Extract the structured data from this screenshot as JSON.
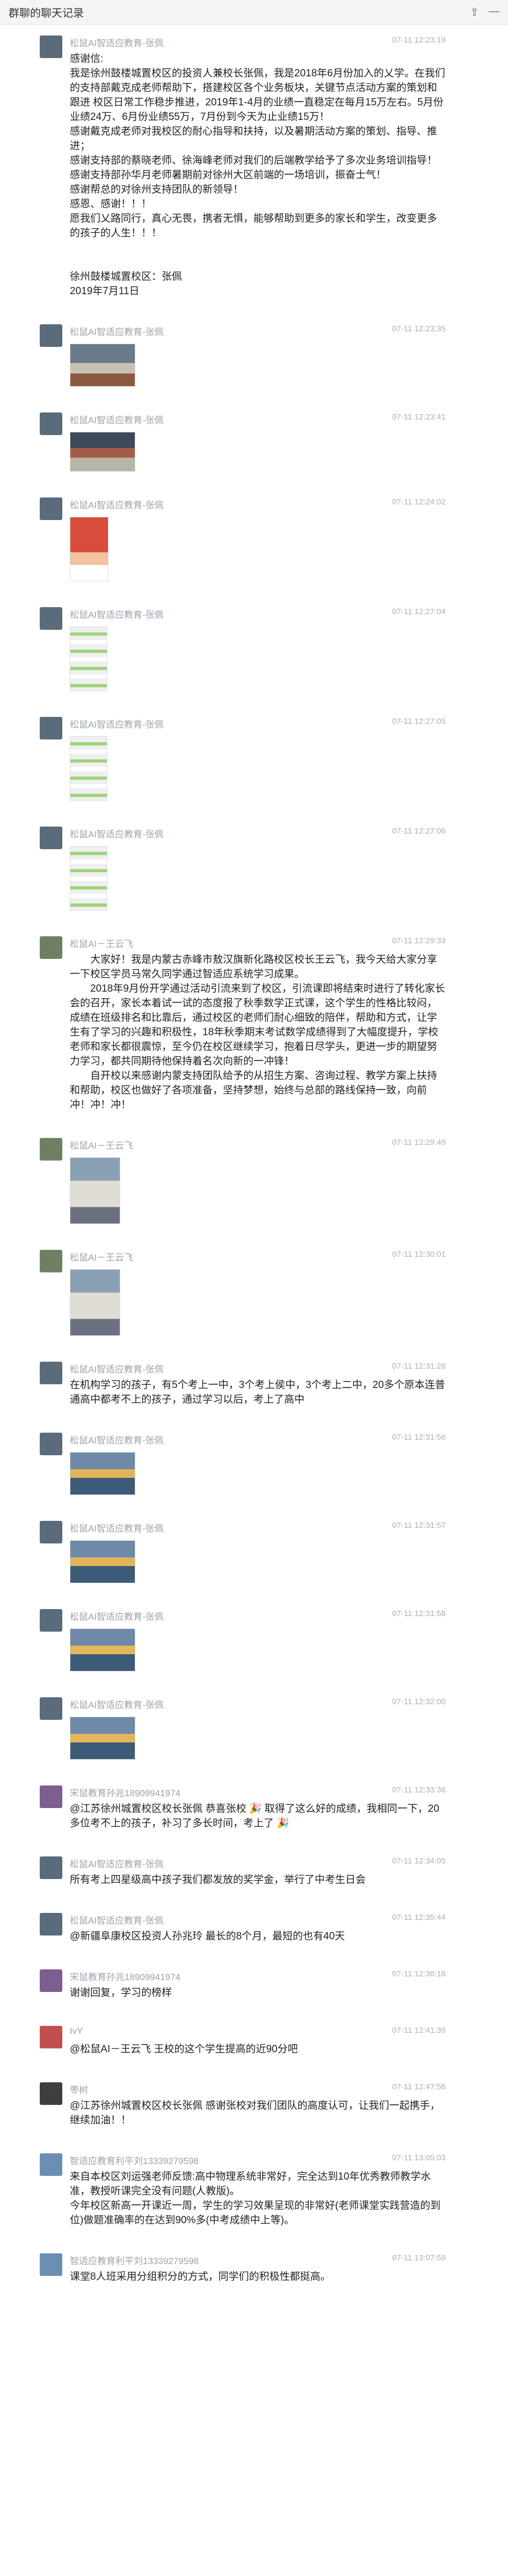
{
  "window": {
    "title": "群聊的聊天记录",
    "share_icon": "share-icon",
    "minimize_icon": "minimize-icon"
  },
  "messages": [
    {
      "sender": "松鼠AI智适应教育-张佩",
      "time": "07-11 12:23:19",
      "avatar_color": "#5a6b7a",
      "lines": [
        "感谢信:",
        "我是徐州鼓楼城置校区的投资人兼校长张佩，我是2018年6月份加入的乂学。在我们的支持部戴克成老师帮助下，搭建校区各个业务板块，关键节点活动方案的策划和跟进 校区日常工作稳步推进，2019年1-4月的业绩一直稳定在每月15万左右。5月份业绩24万、6月份业绩55万，7月份到今天为止业绩15万！",
        "感谢戴克成老师对我校区的耐心指导和扶持，以及暑期活动方案的策划、指导、推进；",
        "感谢支持部的蔡晓老师、徐海峰老师对我们的后端教学给予了多次业务培训指导！",
        "感谢支持部孙华月老师暑期前对徐州大区前端的一场培训，振奋士气！",
        "感谢帮总的对徐州支持团队的新领导！",
        "感恩、感谢！！！",
        "愿我们乂路同行，真心无畏，携者无惧，能够帮助到更多的家长和学生，改变更多的孩子的人生！！！",
        "",
        "",
        "徐州鼓楼城置校区：张佩",
        "2019年7月11日"
      ]
    },
    {
      "sender": "松鼠AI智适应教育-张佩",
      "time": "07-11 12:23:35",
      "image": "classroom-photo"
    },
    {
      "sender": "松鼠AI智适应教育-张佩",
      "time": "07-11 12:23:41",
      "image": "meeting-photo"
    },
    {
      "sender": "松鼠AI智适应教育-张佩",
      "time": "07-11 12:24:02",
      "image": "poster-photo"
    },
    {
      "sender": "松鼠AI智适应教育-张佩",
      "time": "07-11 12:27:04",
      "image": "chat-screenshot"
    },
    {
      "sender": "松鼠AI智适应教育-张佩",
      "time": "07-11 12:27:05",
      "image": "chat-screenshot"
    },
    {
      "sender": "松鼠AI智适应教育-张佩",
      "time": "07-11 12:27:06",
      "image": "chat-screenshot"
    },
    {
      "sender": "松鼠AI－王云飞",
      "time": "07-11 12:29:33",
      "avatar_color": "#6f7f63",
      "paragraphs": [
        "大家好！我是内蒙古赤峰市敖汉旗新化路校区校长王云飞，我今天给大家分享一下校区学员马常久同学通过智适应系统学习成果。",
        "2018年9月份开学通过活动引流来到了校区，引流课即将结束时进行了转化家长会的召开，家长本着试一试的态度报了秋季数学正式课，这个学生的性格比较闷，成绩在班级排名和比靠后，通过校区的老师们耐心细致的陪伴，帮助和方式，让学生有了学习的兴趣和积极性，18年秋季期末考试数学成绩得到了大幅度提升，学校老师和家长都很震惊，至今仍在校区继续学习，抱着日尽学头，更进一步的期望努力学习，都共同期待他保持着名次向新的一冲锋！",
        "自开校以来感谢内蒙支持团队给予的从招生方案、咨询过程、教学方案上扶持和帮助，校区也做好了各项准备，坚持梦想，始终与总部的路线保持一致，向前冲！冲！冲！"
      ]
    },
    {
      "sender": "松鼠AI－王云飞",
      "time": "07-11 12:29:49",
      "image": "student-photo"
    },
    {
      "sender": "松鼠AI－王云飞",
      "time": "07-11 12:30:01",
      "image": "student-photo"
    },
    {
      "sender": "松鼠AI智适应教育-张佩",
      "time": "07-11 12:31:28",
      "lines": [
        "在机构学习的孩子，有5个考上一中，3个考上侯中，3个考上二中，20多个原本连普通高中都考不上的孩子，通过学习以后，考上了高中"
      ]
    },
    {
      "sender": "松鼠AI智适应教育-张佩",
      "time": "07-11 12:31:56",
      "image": "group-photo"
    },
    {
      "sender": "松鼠AI智适应教育-张佩",
      "time": "07-11 12:31:57",
      "image": "group-photo"
    },
    {
      "sender": "松鼠AI智适应教育-张佩",
      "time": "07-11 12:31:58",
      "image": "group-photo"
    },
    {
      "sender": "松鼠AI智适应教育-张佩",
      "time": "07-11 12:32:00",
      "image": "group-photo"
    },
    {
      "sender": "宋鼠教育孙兆18909941974",
      "time": "07-11 12:33:36",
      "lines": [
        "@江苏徐州城置校区校长张佩 恭喜张校 🎉 取得了这么好的成绩，我相同一下，20多位考不上的孩子，补习了多长时间，考上了 🎉"
      ]
    },
    {
      "sender": "松鼠AI智适应教育-张佩",
      "time": "07-11 12:34:05",
      "lines": [
        "所有考上四星级高中孩子我们都发放的奖学金，举行了中考生日会"
      ]
    },
    {
      "sender": "松鼠AI智适应教育-张佩",
      "time": "07-11 12:35:44",
      "lines": [
        "@新疆阜康校区投资人孙兆玲 最长的8个月，最短的也有40天"
      ]
    },
    {
      "sender": "宋鼠教育孙兆18909941974",
      "time": "07-11 12:36:18",
      "lines": [
        "谢谢回复，学习的榜样"
      ]
    },
    {
      "sender": "IvY",
      "time": "07-11 12:41:39",
      "lines": [
        "@松鼠AI－王云飞 王校的这个学生提高的近90分吧"
      ]
    },
    {
      "sender": "枣树",
      "time": "07-11 12:47:56",
      "lines": [
        "@江苏徐州城置校区校长张佩 感谢张校对我们团队的高度认可，让我们一起携手，继续加油！！"
      ]
    },
    {
      "sender": "智适应教育利平刘13339279598",
      "time": "07-11 13:05:03",
      "lines": [
        "来自本校区刘运强老师反馈:高中物理系统非常好，完全达到10年优秀教师教学水准，教授听课完全没有问题(人教版)。",
        "今年校区新高一开课近一周，学生的学习效果呈现的非常好(老师课堂实践营造的到位)做题准确率的在达到90%多(中考成绩中上等)。"
      ]
    },
    {
      "sender": "智适应教育利平刘13339279598",
      "time": "07-11 13:07:59",
      "lines": [
        "课堂8人班采用分组积分的方式，同学们的积极性都挺高。"
      ]
    }
  ]
}
